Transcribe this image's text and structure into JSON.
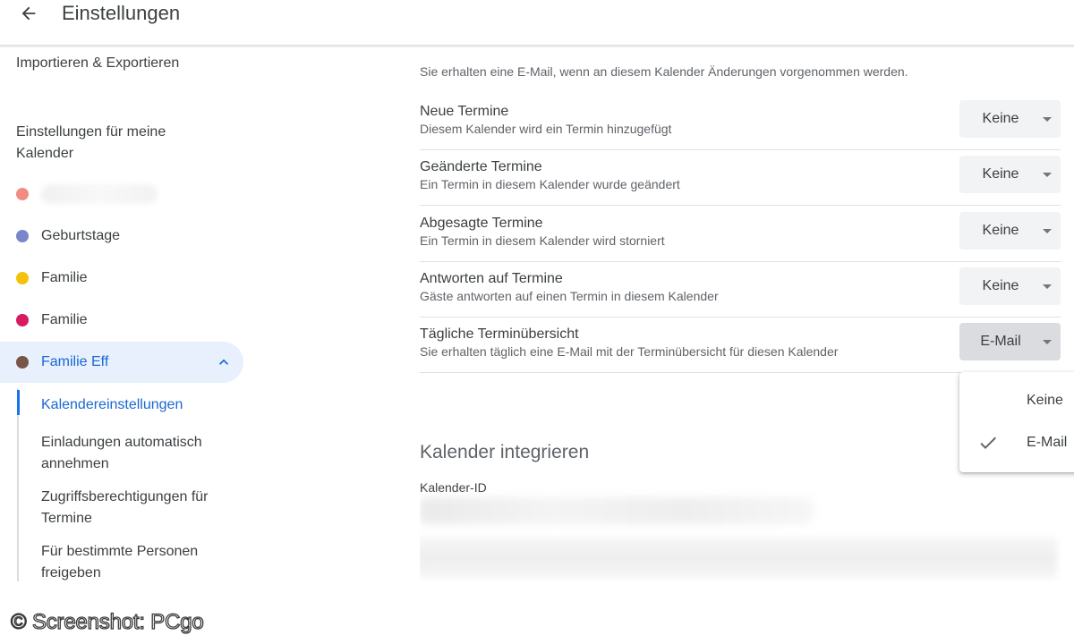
{
  "header": {
    "title": "Einstellungen",
    "back_icon": "arrow-back-icon"
  },
  "sidebar": {
    "import_export": "Importieren & Exportieren",
    "section_title": "Einstellungen für meine Kalender",
    "calendars": [
      {
        "label": "",
        "color": "#f28b82"
      },
      {
        "label": "Geburtstage",
        "color": "#7986cb"
      },
      {
        "label": "Familie",
        "color": "#f4c20d"
      },
      {
        "label": "Familie",
        "color": "#d81b60"
      },
      {
        "label": "Familie Eff",
        "color": "#795548",
        "active": true
      }
    ],
    "subnav": [
      {
        "label": "Kalendereinstellungen",
        "active": true
      },
      {
        "label": "Einladungen automatisch annehmen"
      },
      {
        "label": "Zugriffsberechtigungen für Termine"
      },
      {
        "label": "Für bestimmte Personen freigeben"
      }
    ]
  },
  "main": {
    "intro": "Sie erhalten eine E-Mail, wenn an diesem Kalender Änderungen vorgenommen werden.",
    "rows": [
      {
        "title": "Neue Termine",
        "subtitle": "Diesem Kalender wird ein Termin hinzugefügt",
        "value": "Keine"
      },
      {
        "title": "Geänderte Termine",
        "subtitle": "Ein Termin in diesem Kalender wurde geändert",
        "value": "Keine"
      },
      {
        "title": "Abgesagte Termine",
        "subtitle": "Ein Termin in diesem Kalender wird storniert",
        "value": "Keine"
      },
      {
        "title": "Antworten auf Termine",
        "subtitle": "Gäste antworten auf einen Termin in diesem Kalender",
        "value": "Keine"
      },
      {
        "title": "Tägliche Terminübersicht",
        "subtitle": "Sie erhalten täglich eine E-Mail mit der Terminübersicht für diesen Kalender",
        "value": "E-Mail"
      }
    ],
    "dropdown_menu": {
      "options": [
        "Keine",
        "E-Mail"
      ],
      "selected": "E-Mail"
    },
    "integrate_title": "Kalender integrieren",
    "calendar_id_label": "Kalender-ID"
  },
  "colors": {
    "accent": "#1a73e8",
    "active_bg": "#e8f0fe",
    "active_text": "#1967d2"
  },
  "credit": "© Screenshot: PCgo"
}
